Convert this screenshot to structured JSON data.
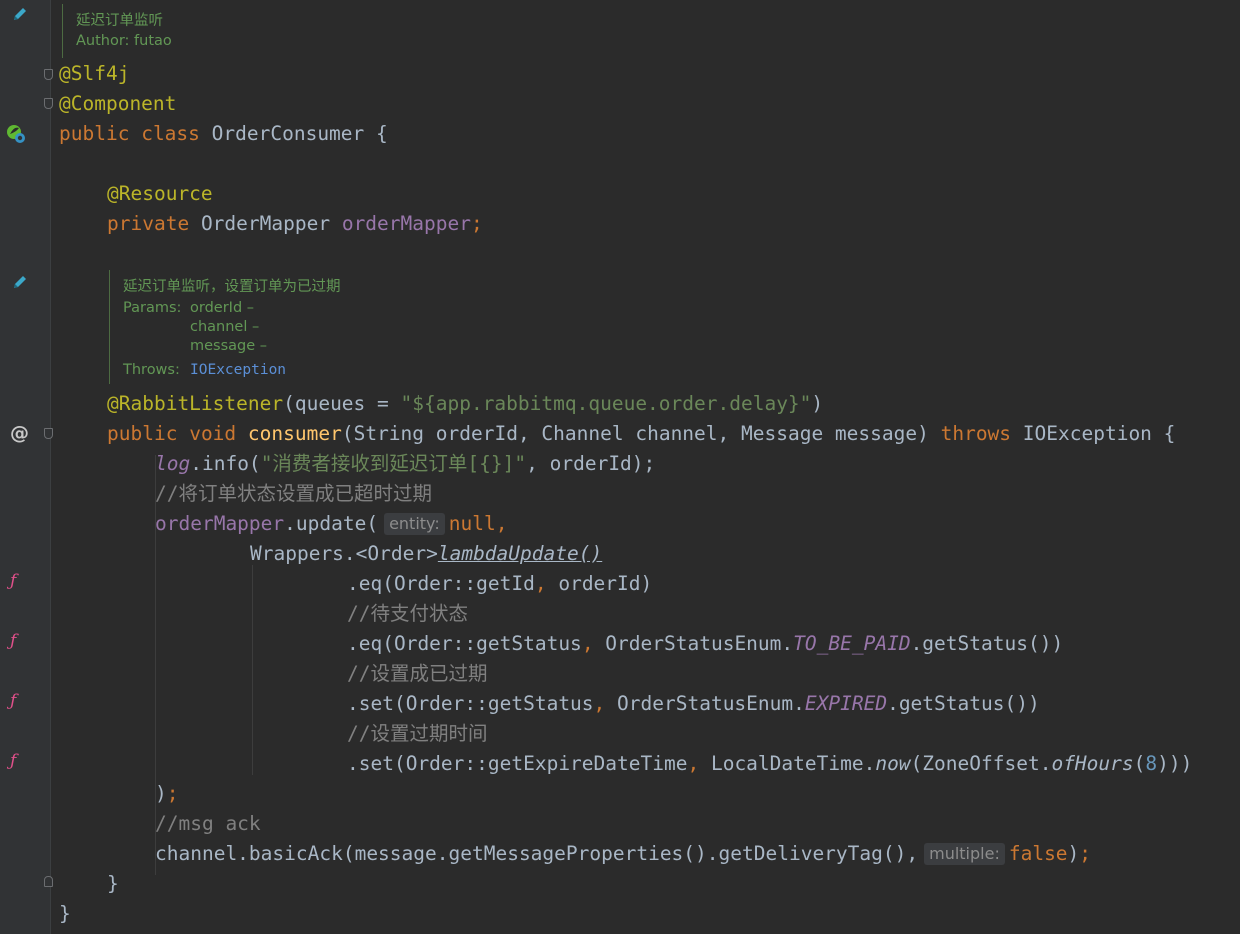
{
  "doc_class": {
    "title": "延迟订单监听",
    "author": "Author: futao"
  },
  "doc_method": {
    "title": "延迟订单监听，设置订单为已过期",
    "params_label": "Params:",
    "params": [
      "orderId –",
      "channel –",
      "message –"
    ],
    "throws_label": "Throws:",
    "throws_value": "IOException"
  },
  "code": {
    "ann_slf4j": "@Slf4j",
    "ann_component": "@Component",
    "kw_public": "public",
    "kw_class": "class",
    "class_name": "OrderConsumer",
    "brace_open": "{",
    "ann_resource": "@Resource",
    "kw_private": "private",
    "type_mapper": "OrderMapper",
    "field_mapper": "orderMapper",
    "semicolon": ";",
    "ann_listener": "@RabbitListener",
    "listener_args_start": "(queues = ",
    "listener_queue": "\"${app.rabbitmq.queue.order.delay}\"",
    "paren_close": ")",
    "kw_void": "void",
    "method_name": "consumer",
    "method_params": "(String orderId, Channel channel, Message message) ",
    "kw_throws": "throws",
    "method_throws": " IOException {",
    "log_field": "log",
    "log_call": ".info(",
    "log_string": "\"消费者接收到延迟订单[{}]\"",
    "log_args": ", orderId);",
    "comment_status": "//将订单状态设置成已超时过期",
    "update_field": "orderMapper",
    "update_call": ".update(",
    "hint_entity": "entity:",
    "kw_null": "null",
    "comma": ",",
    "wrappers": "Wrappers.<Order>",
    "lambda_update": "lambdaUpdate()",
    "eq_id": ".eq(Order::getId",
    "eq_id_rest": " orderId)",
    "comment_to_pay": "//待支付状态",
    "eq_status": ".eq(Order::getStatus",
    "enum_class": " OrderStatusEnum.",
    "enum_to_be_paid": "TO_BE_PAID",
    "get_status_call": ".getStatus())",
    "comment_expired": "//设置成已过期",
    "set_status": ".set(Order::getStatus",
    "enum_expired": "EXPIRED",
    "comment_expire_time": "//设置过期时间",
    "set_expire": ".set(Order::getExpireDateTime",
    "local_date_time": " LocalDateTime.",
    "now_call": "now",
    "zone_offset": "(ZoneOffset.",
    "of_hours": "ofHours",
    "paren_open": "(",
    "hours_value": "8",
    "closing_parens": ")))",
    "close_paren": ")",
    "comment_ack": "//msg ack",
    "basic_ack": "channel.basicAck(message.getMessageProperties().getDeliveryTag(),",
    "hint_multiple": "multiple:",
    "kw_false": "false",
    "brace_close": "}"
  },
  "gutter_icons": [
    "edit-doc-icon",
    "spring-bean-icon",
    "edit-doc-icon",
    "override-at-icon",
    "lambda-icon",
    "lambda-icon",
    "lambda-icon",
    "lambda-icon"
  ],
  "colors": {
    "background": "#2b2b2b",
    "gutter": "#313335",
    "keyword": "#cc7832",
    "annotation": "#bbb529",
    "field": "#9876aa",
    "string": "#6a8759",
    "doc_comment": "#629755",
    "method_decl": "#ffc66d",
    "comment": "#808080",
    "number": "#6897bb"
  }
}
